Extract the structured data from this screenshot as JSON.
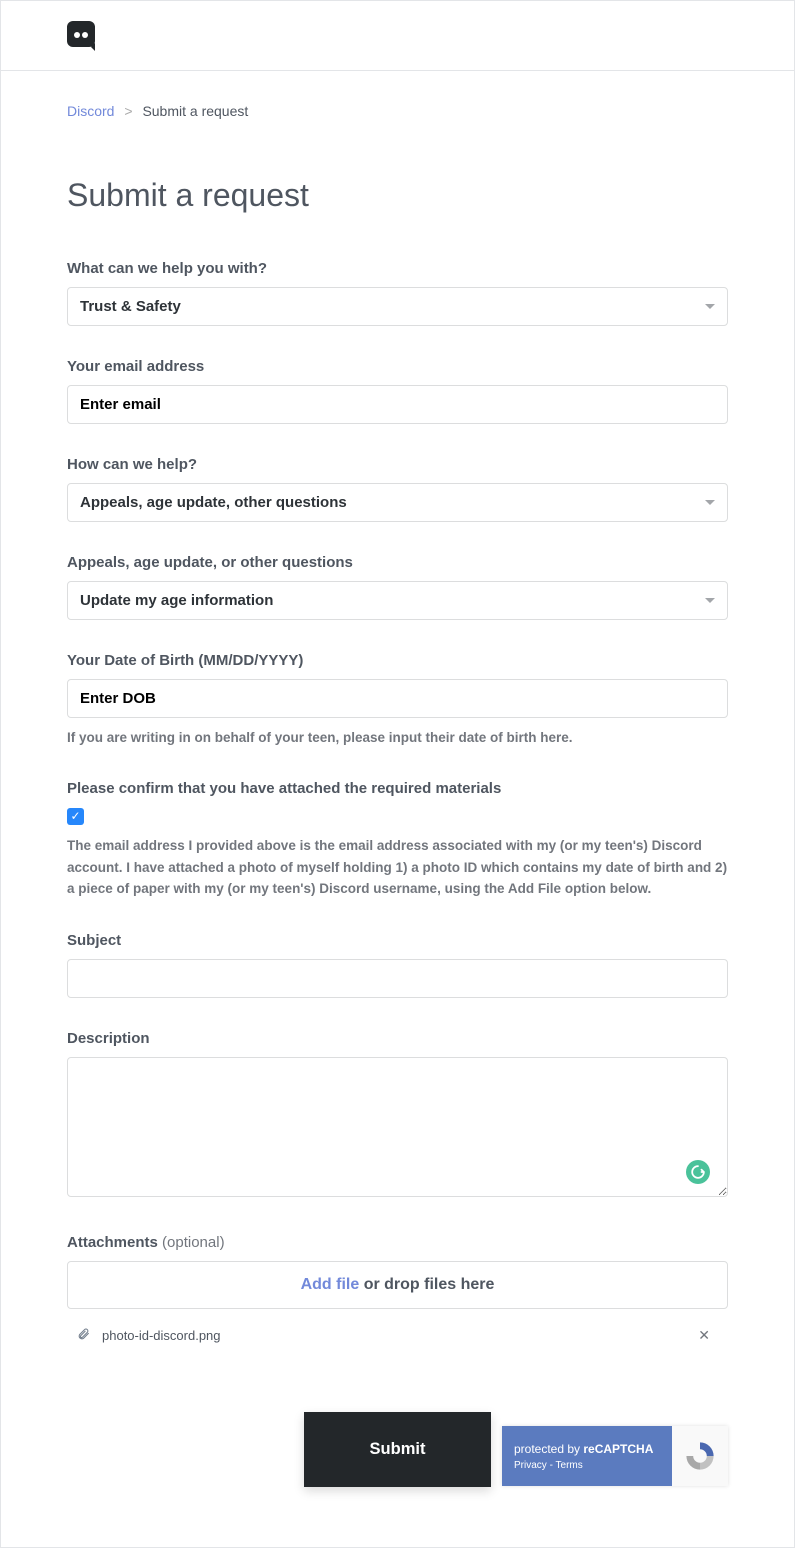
{
  "breadcrumb": {
    "link": "Discord",
    "current": "Submit a request"
  },
  "page_title": "Submit a request",
  "fields": {
    "help_with": {
      "label": "What can we help you with?",
      "value": "Trust & Safety"
    },
    "email": {
      "label": "Your email address",
      "placeholder": "Enter email"
    },
    "how_help": {
      "label": "How can we help?",
      "value": "Appeals, age update, other questions"
    },
    "appeals": {
      "label": "Appeals, age update, or other questions",
      "value": "Update my age information"
    },
    "dob": {
      "label": "Your Date of Birth (MM/DD/YYYY)",
      "placeholder": "Enter DOB",
      "help": "If you are writing in on behalf of your teen, please input their date of birth here."
    },
    "confirm": {
      "label": "Please confirm that you have attached the required materials",
      "checked": true,
      "text": "The email address I provided above is the email address associated with my (or my teen's) Discord account. I have attached a photo of myself holding 1) a photo ID which contains my date of birth and 2) a piece of paper with my (or my teen's) Discord username, using the Add File option below."
    },
    "subject": {
      "label": "Subject",
      "value": ""
    },
    "description": {
      "label": "Description",
      "value": ""
    },
    "attachments": {
      "label": "Attachments ",
      "optional": "(optional)",
      "add": "Add file",
      "drop": " or drop files here",
      "file": "photo-id-discord.png"
    }
  },
  "submit": "Submit",
  "recaptcha": {
    "protected": "protected by ",
    "brand": "reCAPTCHA",
    "privacy": "Privacy",
    "dash": " - ",
    "terms": "Terms"
  }
}
